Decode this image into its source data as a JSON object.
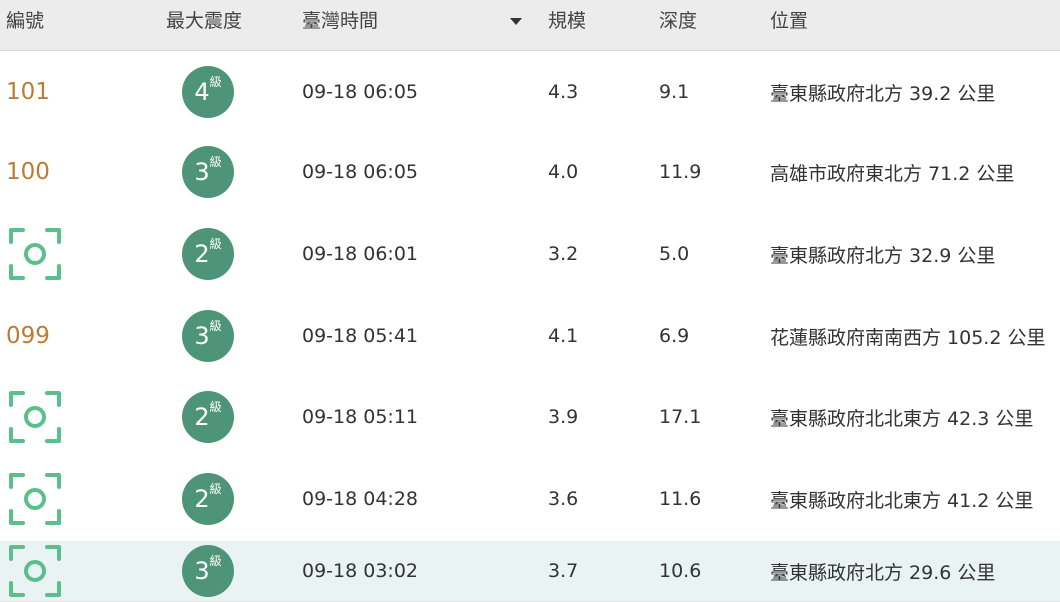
{
  "colors": {
    "accent_number": "#c07a33",
    "badge": "#4e9478",
    "scan_icon": "#5bbf8c",
    "header_bg": "#ececec",
    "highlight_row": "#e9f3f4"
  },
  "header": {
    "id": "編號",
    "max_intensity": "最大震度",
    "time": "臺灣時間",
    "magnitude": "規模",
    "depth": "深度",
    "location": "位置"
  },
  "rows": [
    {
      "id": "101",
      "id_icon": null,
      "intensity": "4",
      "intensity_unit": "級",
      "time": "09-18 06:05",
      "magnitude": "4.3",
      "depth": "9.1",
      "location": "臺東縣政府北方 39.2 公里"
    },
    {
      "id": "100",
      "id_icon": null,
      "intensity": "3",
      "intensity_unit": "級",
      "time": "09-18 06:05",
      "magnitude": "4.0",
      "depth": "11.9",
      "location": "高雄市政府東北方 71.2 公里"
    },
    {
      "id": "",
      "id_icon": "scan-icon",
      "intensity": "2",
      "intensity_unit": "級",
      "time": "09-18 06:01",
      "magnitude": "3.2",
      "depth": "5.0",
      "location": "臺東縣政府北方 32.9 公里"
    },
    {
      "id": "099",
      "id_icon": null,
      "intensity": "3",
      "intensity_unit": "級",
      "time": "09-18 05:41",
      "magnitude": "4.1",
      "depth": "6.9",
      "location": "花蓮縣政府南南西方 105.2 公里"
    },
    {
      "id": "",
      "id_icon": "scan-icon",
      "intensity": "2",
      "intensity_unit": "級",
      "time": "09-18 05:11",
      "magnitude": "3.9",
      "depth": "17.1",
      "location": "臺東縣政府北北東方 42.3 公里"
    },
    {
      "id": "",
      "id_icon": "scan-icon",
      "intensity": "2",
      "intensity_unit": "級",
      "time": "09-18 04:28",
      "magnitude": "3.6",
      "depth": "11.6",
      "location": "臺東縣政府北北東方 41.2 公里"
    },
    {
      "id": "",
      "id_icon": "scan-icon",
      "intensity": "3",
      "intensity_unit": "級",
      "time": "09-18 03:02",
      "magnitude": "3.7",
      "depth": "10.6",
      "location": "臺東縣政府北方 29.6 公里"
    }
  ]
}
